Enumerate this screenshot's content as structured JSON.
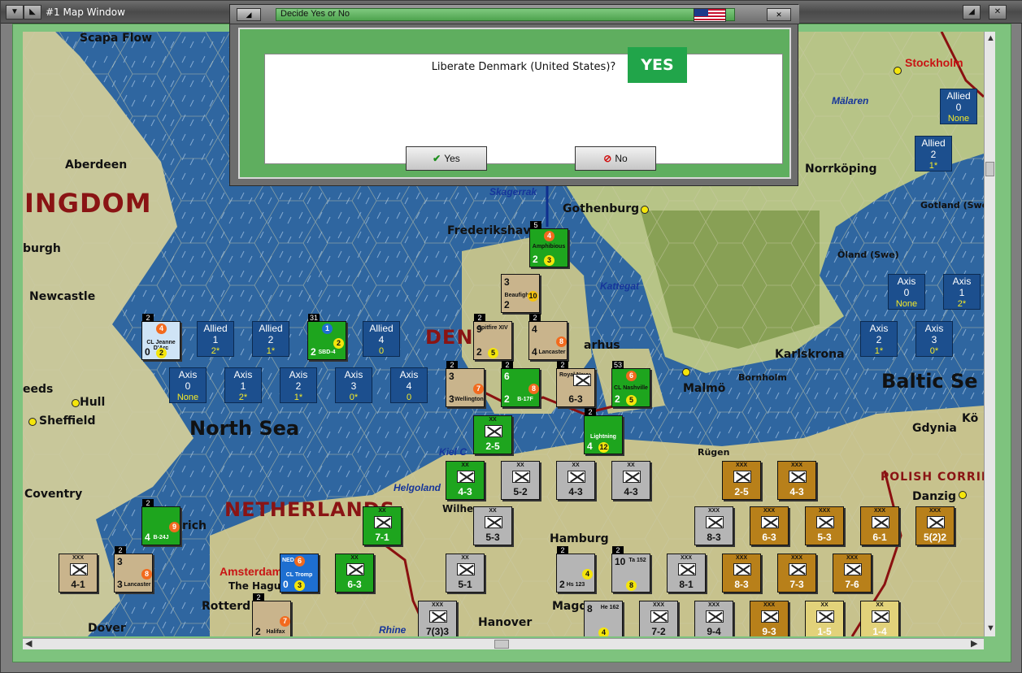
{
  "window": {
    "title": "#1 Map Window"
  },
  "dialog": {
    "title": "Decide Yes or No",
    "question": "Liberate Denmark (United States)?",
    "yes_tag": "YES",
    "yes_label": "Yes",
    "no_label": "No",
    "flag": "us-flag-icon"
  },
  "map": {
    "countries": [
      {
        "name": "INGDOM"
      },
      {
        "name": "DEN"
      },
      {
        "name": "NETHERLANDS"
      },
      {
        "name": "POLISH CORRID"
      }
    ],
    "seas": [
      {
        "name": "North Sea"
      },
      {
        "name": "Baltic Se"
      },
      {
        "name": "Skagerrak"
      },
      {
        "name": "Kattegat"
      },
      {
        "name": "Mälaren"
      },
      {
        "name": "Kiel C"
      },
      {
        "name": "Helgoland"
      },
      {
        "name": "Rhine"
      }
    ],
    "cities": [
      {
        "name": "Scapa Flow"
      },
      {
        "name": "Aberdeen"
      },
      {
        "name": "burgh"
      },
      {
        "name": "Newcastle"
      },
      {
        "name": "eeds"
      },
      {
        "name": "Hull"
      },
      {
        "name": "Sheffield"
      },
      {
        "name": "Coventry"
      },
      {
        "name": "Dover"
      },
      {
        "name": "Stockholm"
      },
      {
        "name": "Norrköping"
      },
      {
        "name": "Gotland (Swe)"
      },
      {
        "name": "Öland (Swe)"
      },
      {
        "name": "Karlskrona"
      },
      {
        "name": "Bornholm"
      },
      {
        "name": "Malmö"
      },
      {
        "name": "Gothenburg"
      },
      {
        "name": "Frederikshav"
      },
      {
        "name": "arhus"
      },
      {
        "name": "Gdynia"
      },
      {
        "name": "Danzig"
      },
      {
        "name": "Rügen"
      },
      {
        "name": "Hamburg"
      },
      {
        "name": "Hanover"
      },
      {
        "name": "Magd"
      },
      {
        "name": "Amsterdam"
      },
      {
        "name": "The Hague"
      },
      {
        "name": "Rotterd"
      },
      {
        "name": "rich"
      },
      {
        "name": "Wilhe"
      },
      {
        "name": "Kö"
      }
    ],
    "allied_boxes": [
      {
        "label": "Allied",
        "value": "0",
        "sub": "None"
      },
      {
        "label": "Allied",
        "value": "2",
        "sub": "1*"
      },
      {
        "label": "Allied",
        "value": "1",
        "sub": "2*"
      },
      {
        "label": "Allied",
        "value": "2",
        "sub": "1*"
      },
      {
        "label": "Allied",
        "value": "4",
        "sub": "0"
      }
    ],
    "axis_boxes_north": [
      {
        "label": "Axis",
        "value": "0",
        "sub": "None"
      },
      {
        "label": "Axis",
        "value": "1",
        "sub": "2*"
      },
      {
        "label": "Axis",
        "value": "2",
        "sub": "1*"
      },
      {
        "label": "Axis",
        "value": "3",
        "sub": "0*"
      },
      {
        "label": "Axis",
        "value": "4",
        "sub": "0"
      }
    ],
    "axis_boxes_east": [
      {
        "label": "Axis",
        "value": "0",
        "sub": "None"
      },
      {
        "label": "Axis",
        "value": "1",
        "sub": "2*"
      },
      {
        "label": "Axis",
        "value": "2",
        "sub": "1*"
      },
      {
        "label": "Axis",
        "value": "3",
        "sub": "0*"
      }
    ],
    "counters": [
      {
        "strength": "4-3",
        "top": "XX",
        "color": "green"
      },
      {
        "strength": "5-2",
        "top": "XX",
        "color": "grey"
      },
      {
        "strength": "4-3",
        "top": "XX",
        "color": "grey"
      },
      {
        "strength": "4-3",
        "top": "XX",
        "color": "grey"
      },
      {
        "strength": "2-5",
        "top": "XX",
        "color": "green"
      },
      {
        "strength": "7-1",
        "top": "XX",
        "color": "green"
      },
      {
        "strength": "5-3",
        "top": "XX",
        "color": "grey"
      },
      {
        "strength": "6-3",
        "top": "XX",
        "color": "green"
      },
      {
        "strength": "5-1",
        "top": "XX",
        "color": "grey"
      },
      {
        "strength": "4-1",
        "top": "XXX",
        "color": "tan"
      },
      {
        "strength": "6-3",
        "top": "",
        "color": "tan"
      },
      {
        "strength": "2-5",
        "top": "XXX",
        "color": "brown"
      },
      {
        "strength": "4-3",
        "top": "XXX",
        "color": "brown"
      },
      {
        "strength": "8-3",
        "top": "XXX",
        "color": "grey"
      },
      {
        "strength": "6-3",
        "top": "XXX",
        "color": "brown"
      },
      {
        "strength": "5-3",
        "top": "XXX",
        "color": "brown"
      },
      {
        "strength": "6-1",
        "top": "XXX",
        "color": "brown"
      },
      {
        "strength": "5(2)2",
        "top": "XXX",
        "color": "brown"
      },
      {
        "strength": "8-1",
        "top": "XXX",
        "color": "grey"
      },
      {
        "strength": "8-3",
        "top": "XXX",
        "color": "brown"
      },
      {
        "strength": "7-3",
        "top": "XXX",
        "color": "brown"
      },
      {
        "strength": "7-6",
        "top": "XXX",
        "color": "brown"
      },
      {
        "strength": "7(3)3",
        "top": "XXX",
        "color": "grey"
      },
      {
        "strength": "7-2",
        "top": "XXX",
        "color": "grey"
      },
      {
        "strength": "9-4",
        "top": "XXX",
        "color": "grey"
      },
      {
        "strength": "9-3",
        "top": "XXX",
        "color": "brown"
      },
      {
        "strength": "1-5",
        "top": "XX",
        "color": "brown"
      },
      {
        "strength": "1-4",
        "top": "XX",
        "color": "brown"
      }
    ],
    "air_units": [
      {
        "name": "Amphibious",
        "color": "green",
        "top_val": "4",
        "bottom_left": "2",
        "bottom_val": "3",
        "badge": "5"
      },
      {
        "name": "Beaufighter",
        "color": "tan",
        "top_val": "3",
        "bottom_left": "2",
        "bottom_val": "10",
        "badge": ""
      },
      {
        "name": "Spitfire XIV",
        "color": "tan",
        "top_val": "9",
        "bottom_left": "2",
        "bottom_val": "5",
        "badge": "2"
      },
      {
        "name": "Lancaster",
        "color": "tan",
        "top_val": "4",
        "bottom_left": "4",
        "bottom_val": "8",
        "badge": "2"
      },
      {
        "name": "Wellington",
        "color": "tan",
        "top_val": "3",
        "bottom_left": "3",
        "bottom_val": "7",
        "badge": "2"
      },
      {
        "name": "B-17F",
        "color": "green",
        "top_val": "6",
        "bottom_left": "2",
        "bottom_val": "8",
        "badge": "2"
      },
      {
        "name": "Royal Navy",
        "color": "tan",
        "top_val": "",
        "bottom_left": "",
        "bottom_val": "6-3",
        "badge": "2"
      },
      {
        "name": "CL Nashville",
        "color": "green",
        "top_val": "6",
        "bottom_left": "2",
        "bottom_val": "5",
        "badge": "53"
      },
      {
        "name": "Lightning",
        "color": "green",
        "top_val": "",
        "bottom_left": "4",
        "bottom_val": "12",
        "badge": "2"
      },
      {
        "name": "CL Jeanne D'Arc",
        "color": "light",
        "top_val": "4",
        "bottom_left": "0",
        "bottom_val": "2",
        "badge": "2"
      },
      {
        "name": "SBD-4",
        "color": "green",
        "top_val": "1",
        "bottom_left": "2",
        "bottom_val": "2",
        "badge": "31"
      },
      {
        "name": "B-24J",
        "color": "green",
        "top_val": "",
        "bottom_left": "4",
        "bottom_val": "9",
        "badge": "2"
      },
      {
        "name": "Lancaster",
        "color": "tan",
        "top_val": "3",
        "bottom_left": "3",
        "bottom_val": "8",
        "badge": "2"
      },
      {
        "name": "CL Tromp",
        "color": "blue",
        "top_val": "6",
        "bottom_left": "0",
        "bottom_val": "3",
        "badge": "NED"
      },
      {
        "name": "Halifax",
        "color": "tan",
        "top_val": "",
        "bottom_left": "2",
        "bottom_val": "7",
        "badge": "2"
      },
      {
        "name": "Hs 123",
        "color": "grey",
        "top_val": "",
        "bottom_left": "2",
        "bottom_val": "4",
        "badge": "2"
      },
      {
        "name": "Ta 152",
        "color": "grey",
        "top_val": "10",
        "bottom_left": "",
        "bottom_val": "8",
        "badge": "2"
      },
      {
        "name": "He 162",
        "color": "grey",
        "top_val": "8",
        "bottom_left": "",
        "bottom_val": "4",
        "badge": ""
      }
    ]
  }
}
